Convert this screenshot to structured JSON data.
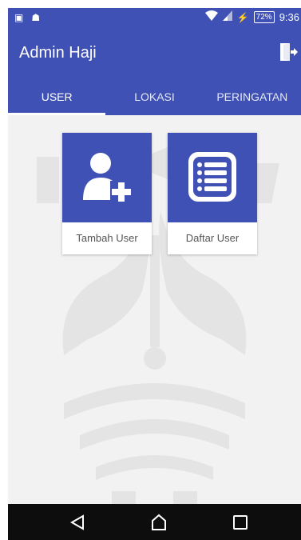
{
  "statusbar": {
    "left_icons": [
      "bbm-icon",
      "android-icon"
    ],
    "battery": "72%",
    "time": "9:36"
  },
  "appbar": {
    "title": "Admin Haji"
  },
  "tabs": [
    {
      "label": "USER",
      "active": true
    },
    {
      "label": "LOKASI",
      "active": false
    },
    {
      "label": "PERINGATAN",
      "active": false
    }
  ],
  "cards": [
    {
      "label": "Tambah User",
      "icon": "add-user-icon"
    },
    {
      "label": "Daftar User",
      "icon": "list-icon"
    }
  ],
  "navbar": {
    "buttons": [
      "back",
      "home",
      "recents"
    ]
  },
  "colors": {
    "primary": "#3f51b5",
    "background": "#f2f2f2",
    "navbar": "#0d0d0d"
  }
}
